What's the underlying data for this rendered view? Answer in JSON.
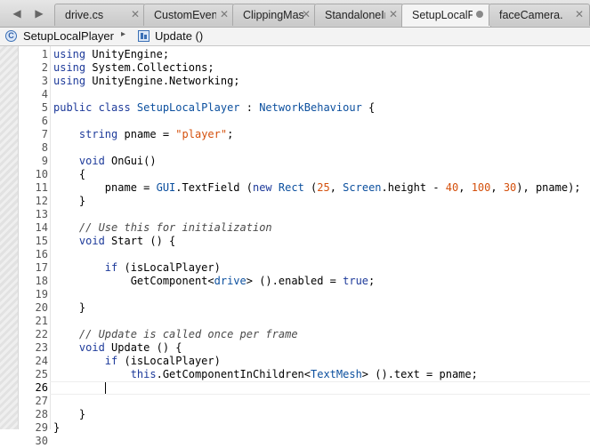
{
  "tabs": [
    {
      "label": "drive.cs",
      "active": false
    },
    {
      "label": "CustomEvent",
      "active": false
    },
    {
      "label": "ClippingMask",
      "active": false
    },
    {
      "label": "StandaloneInp",
      "active": false
    },
    {
      "label": "SetupLocalPl",
      "active": true
    },
    {
      "label": "faceCamera.c",
      "active": false
    }
  ],
  "breadcrumb": {
    "class_name": "SetupLocalPlayer",
    "separator": "▸",
    "method_name": "Update ()"
  },
  "editor": {
    "current_line": 26,
    "lines": [
      {
        "n": "1",
        "tokens": [
          {
            "t": "using",
            "c": "kw"
          },
          {
            "t": " UnityEngine;",
            "c": ""
          }
        ]
      },
      {
        "n": "2",
        "tokens": [
          {
            "t": "using",
            "c": "kw"
          },
          {
            "t": " System.Collections;",
            "c": ""
          }
        ]
      },
      {
        "n": "3",
        "tokens": [
          {
            "t": "using",
            "c": "kw"
          },
          {
            "t": " UnityEngine.Networking;",
            "c": ""
          }
        ]
      },
      {
        "n": "4",
        "tokens": []
      },
      {
        "n": "5",
        "tokens": [
          {
            "t": "public class ",
            "c": "kw"
          },
          {
            "t": "SetupLocalPlayer",
            "c": "ty"
          },
          {
            "t": " : ",
            "c": ""
          },
          {
            "t": "NetworkBehaviour",
            "c": "ty"
          },
          {
            "t": " {",
            "c": ""
          }
        ]
      },
      {
        "n": "6",
        "tokens": []
      },
      {
        "n": "7",
        "tokens": [
          {
            "t": "    ",
            "c": ""
          },
          {
            "t": "string",
            "c": "kw"
          },
          {
            "t": " pname = ",
            "c": ""
          },
          {
            "t": "\"player\"",
            "c": "str"
          },
          {
            "t": ";",
            "c": ""
          }
        ]
      },
      {
        "n": "8",
        "tokens": []
      },
      {
        "n": "9",
        "tokens": [
          {
            "t": "    ",
            "c": ""
          },
          {
            "t": "void",
            "c": "kw"
          },
          {
            "t": " OnGui()",
            "c": ""
          }
        ]
      },
      {
        "n": "10",
        "tokens": [
          {
            "t": "    {",
            "c": ""
          }
        ]
      },
      {
        "n": "11",
        "tokens": [
          {
            "t": "        pname = ",
            "c": ""
          },
          {
            "t": "GUI",
            "c": "ty"
          },
          {
            "t": ".TextField (",
            "c": ""
          },
          {
            "t": "new",
            "c": "kw"
          },
          {
            "t": " ",
            "c": ""
          },
          {
            "t": "Rect",
            "c": "ty"
          },
          {
            "t": " (",
            "c": ""
          },
          {
            "t": "25",
            "c": "num"
          },
          {
            "t": ", ",
            "c": ""
          },
          {
            "t": "Screen",
            "c": "ty"
          },
          {
            "t": ".height - ",
            "c": ""
          },
          {
            "t": "40",
            "c": "num"
          },
          {
            "t": ", ",
            "c": ""
          },
          {
            "t": "100",
            "c": "num"
          },
          {
            "t": ", ",
            "c": ""
          },
          {
            "t": "30",
            "c": "num"
          },
          {
            "t": "), pname);",
            "c": ""
          }
        ]
      },
      {
        "n": "12",
        "tokens": [
          {
            "t": "    }",
            "c": ""
          }
        ]
      },
      {
        "n": "13",
        "tokens": []
      },
      {
        "n": "14",
        "tokens": [
          {
            "t": "    ",
            "c": ""
          },
          {
            "t": "// Use this for initialization",
            "c": "cm"
          }
        ]
      },
      {
        "n": "15",
        "tokens": [
          {
            "t": "    ",
            "c": ""
          },
          {
            "t": "void",
            "c": "kw"
          },
          {
            "t": " Start () {",
            "c": ""
          }
        ]
      },
      {
        "n": "16",
        "tokens": []
      },
      {
        "n": "17",
        "tokens": [
          {
            "t": "        ",
            "c": ""
          },
          {
            "t": "if",
            "c": "kw"
          },
          {
            "t": " (isLocalPlayer)",
            "c": ""
          }
        ]
      },
      {
        "n": "18",
        "tokens": [
          {
            "t": "            GetComponent<",
            "c": ""
          },
          {
            "t": "drive",
            "c": "ty"
          },
          {
            "t": "> ().enabled = ",
            "c": ""
          },
          {
            "t": "true",
            "c": "kw"
          },
          {
            "t": ";",
            "c": ""
          }
        ]
      },
      {
        "n": "19",
        "tokens": []
      },
      {
        "n": "20",
        "tokens": [
          {
            "t": "    }",
            "c": ""
          }
        ]
      },
      {
        "n": "21",
        "tokens": []
      },
      {
        "n": "22",
        "tokens": [
          {
            "t": "    ",
            "c": ""
          },
          {
            "t": "// Update is called once per frame",
            "c": "cm"
          }
        ]
      },
      {
        "n": "23",
        "tokens": [
          {
            "t": "    ",
            "c": ""
          },
          {
            "t": "void",
            "c": "kw"
          },
          {
            "t": " Update () {",
            "c": ""
          }
        ]
      },
      {
        "n": "24",
        "tokens": [
          {
            "t": "        ",
            "c": ""
          },
          {
            "t": "if",
            "c": "kw"
          },
          {
            "t": " (isLocalPlayer)",
            "c": ""
          }
        ]
      },
      {
        "n": "25",
        "tokens": [
          {
            "t": "            ",
            "c": ""
          },
          {
            "t": "this",
            "c": "kw"
          },
          {
            "t": ".GetComponentInChildren<",
            "c": ""
          },
          {
            "t": "TextMesh",
            "c": "ty"
          },
          {
            "t": "> ().text = pname;",
            "c": ""
          }
        ]
      },
      {
        "n": "26",
        "tokens": [
          {
            "t": "        ",
            "c": ""
          }
        ]
      },
      {
        "n": "27",
        "tokens": []
      },
      {
        "n": "28",
        "tokens": [
          {
            "t": "    }",
            "c": ""
          }
        ]
      },
      {
        "n": "29",
        "tokens": [
          {
            "t": "}",
            "c": ""
          }
        ]
      },
      {
        "n": "30",
        "tokens": []
      }
    ]
  }
}
